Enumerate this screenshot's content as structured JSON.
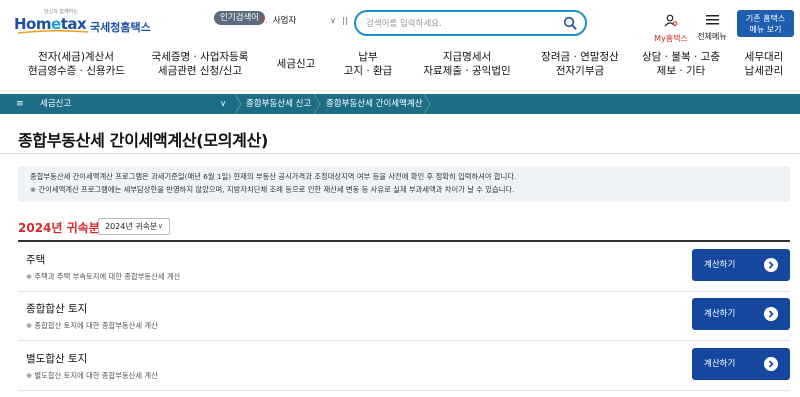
{
  "header": {
    "logo_tagline": "당신과 함께하는",
    "logo_mark_part1": "Hom",
    "logo_mark_part2": "e",
    "logo_mark_part3": "tax",
    "agency": "국세청홈택스",
    "popular_badge": "인기검색어",
    "popular_rank": "7.",
    "popular_term": "사업자",
    "search_placeholder": "검색어를 입력하세요.",
    "my_hometax": "My홈택스",
    "all_menu": "전체메뉴",
    "old_menu_line1": "기존 홈택스",
    "old_menu_line2": "메뉴 보기"
  },
  "gnb": [
    {
      "line1": "전자(세금)계산서",
      "line2": "현금영수증 · 신용카드"
    },
    {
      "line1": "국세증명 · 사업자등록",
      "line2": "세금관련 신청/신고"
    },
    {
      "line1": "세금신고",
      "line2": ""
    },
    {
      "line1": "납부",
      "line2": "고지 · 환급"
    },
    {
      "line1": "지급명세서",
      "line2": "자료제출 · 공익법인"
    },
    {
      "line1": "장려금 · 연말정산",
      "line2": "전자기부금"
    },
    {
      "line1": "상담 · 불복 · 고충",
      "line2": "제보 · 기타"
    },
    {
      "line1": "세무대리",
      "line2": "납세관리"
    }
  ],
  "breadcrumb": {
    "level1": "세금신고",
    "level2": "종합부동산세 신고",
    "level3": "종합부동산세 간이세액계산"
  },
  "page_title": "종합부동산세 간이세액계산(모의계산)",
  "notice": {
    "line1": "종합부동산세 간이세액계산 프로그램은 과세기준일(매년 6월 1일) 현재의 부동산 공시가격과 조정대상지역 여부 등을 사전에 확인 후 정확히 입력하셔야 합니다.",
    "line2": "※ 간이세액계산 프로그램에는 세부담상한을 반영하지 않았으며, 지방자치단체 조례 등으로 인한 재산세 변동 등 사유로 실제 부과세액과 차이가 날 수 있습니다."
  },
  "year": {
    "label": "2024년 귀속분",
    "selected": "2024년 귀속분"
  },
  "tax_items": [
    {
      "name": "주택",
      "desc": "※ 주택과 주택 부속토지에 대한 종합부동산세 계산",
      "button": "계산하기"
    },
    {
      "name": "종합합산 토지",
      "desc": "※ 종합합산 토지에 대한 종합부동산세 계산",
      "button": "계산하기"
    },
    {
      "name": "별도합산 토지",
      "desc": "※ 별도합산 토지에 대한 종합부동산세 계산",
      "button": "계산하기"
    }
  ],
  "colors": {
    "brand_blue": "#1d4fa3",
    "breadcrumb_bg": "#1c6d85",
    "button_blue": "#16479e",
    "accent_red": "#d42a2a"
  },
  "icons": [
    "search-icon",
    "user-icon",
    "hamburger-icon",
    "chevron-down-icon",
    "pause-icon",
    "arrow-right-circle-icon"
  ]
}
